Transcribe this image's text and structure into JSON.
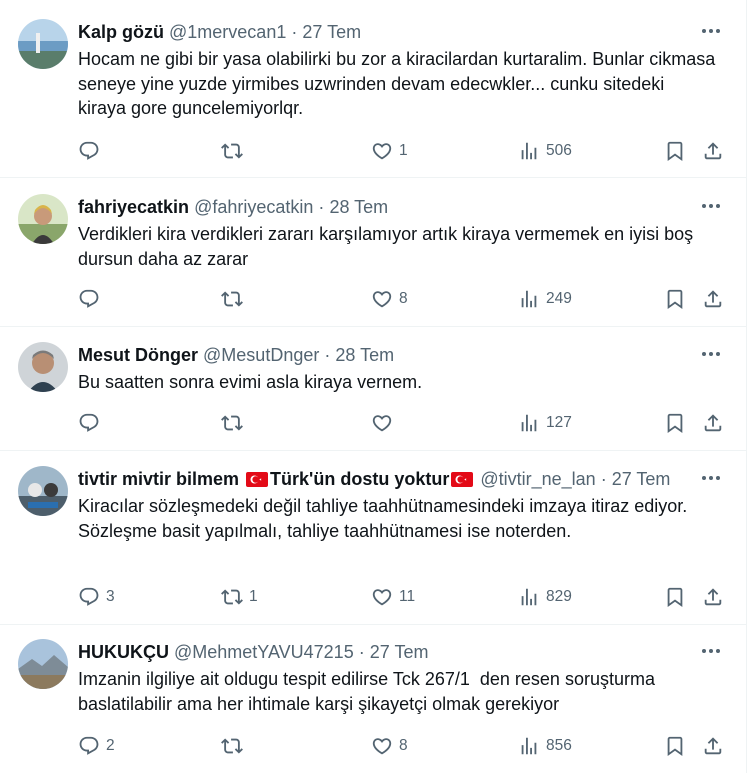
{
  "tweets": [
    {
      "name": "Kalp gözü",
      "handle": "@1mervecan1",
      "time": "27 Tem",
      "text": "Hocam ne gibi bir yasa olabilirki bu zor a kiracilardan kurtaralim. Bunlar cikmasa seneye yine yuzde yirmibes uzwrinden devam edecwkler... cunku sitedeki kiraya gore guncelemiyorlqr.",
      "replies": "",
      "retweets": "",
      "likes": "1",
      "views": "506"
    },
    {
      "name": "fahriyecatkin",
      "handle": "@fahriyecatkin",
      "time": "28 Tem",
      "text": "Verdikleri kira verdikleri zararı karşılamıyor artık kiraya vermemek en iyisi boş dursun daha az zarar",
      "replies": "",
      "retweets": "",
      "likes": "8",
      "views": "249"
    },
    {
      "name": "Mesut Dönger",
      "handle": "@MesutDnger",
      "time": "28 Tem",
      "text": "Bu saatten sonra evimi asla kiraya vernem.",
      "replies": "",
      "retweets": "",
      "likes": "",
      "views": "127"
    },
    {
      "name_part1": "tivtir mivtir bilmem ",
      "name_part2": "Türk'ün dostu yoktur",
      "handle": "@tivtir_ne_lan",
      "time": "27 Tem",
      "text": "Kiracılar sözleşmedeki değil tahliye taahhütnamesindeki imzaya itiraz ediyor.\nSözleşme basit yapılmalı, tahliye taahhütnamesi ise noterden.",
      "replies": "3",
      "retweets": "1",
      "likes": "11",
      "views": "829"
    },
    {
      "name": "HUKUKÇU",
      "handle": "@MehmetYAVU47215",
      "time": "27 Tem",
      "text": "Imzanin ilgiliye ait oldugu tespit edilirse Tck 267/1  den resen soruşturma baslatilabilir ama her ihtimale karşi şikayetçi olmak gerekiyor",
      "replies": "2",
      "retweets": "",
      "likes": "8",
      "views": "856"
    }
  ],
  "separator": "·",
  "colors": {
    "text": "#0f1419",
    "secondary": "#536471",
    "border": "#eff3f4",
    "flag": "#e30a17"
  }
}
